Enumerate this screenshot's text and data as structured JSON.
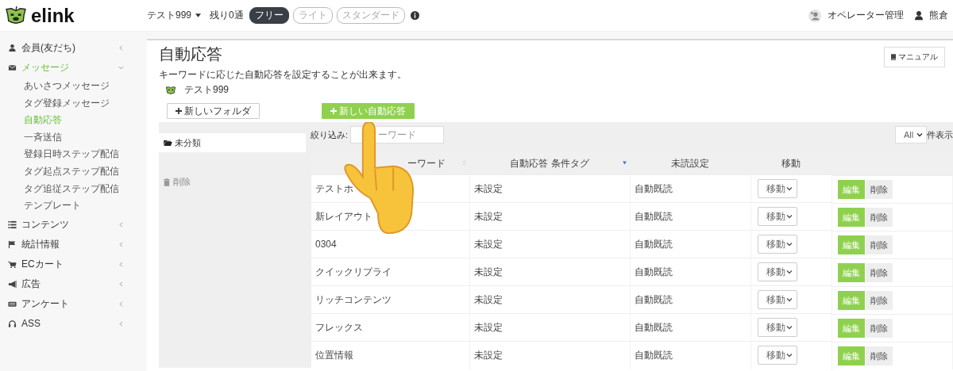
{
  "header": {
    "logo": "elink",
    "account": "テスト999",
    "remaining": "残り0通",
    "plans": [
      {
        "label": "フリー",
        "selected": true
      },
      {
        "label": "ライト",
        "selected": false
      },
      {
        "label": "スタンダード",
        "selected": false
      }
    ],
    "operator": "オペレーター管理",
    "user": "熊倉"
  },
  "sidebar": {
    "items": [
      {
        "label": "会員(友だち)",
        "selected": false,
        "expanded": false
      },
      {
        "label": "メッセージ",
        "selected": true,
        "expanded": true,
        "children": [
          {
            "label": "あいさつメッセージ",
            "selected": false
          },
          {
            "label": "タグ登録メッセージ",
            "selected": false
          },
          {
            "label": "自動応答",
            "selected": true
          },
          {
            "label": "一斉送信",
            "selected": false
          },
          {
            "label": "登録日時ステップ配信",
            "selected": false
          },
          {
            "label": "タグ起点ステップ配信",
            "selected": false
          },
          {
            "label": "タグ追従ステップ配信",
            "selected": false
          },
          {
            "label": "テンプレート",
            "selected": false
          }
        ]
      },
      {
        "label": "コンテンツ",
        "selected": false,
        "expanded": false
      },
      {
        "label": "統計情報",
        "selected": false,
        "expanded": false
      },
      {
        "label": "ECカート",
        "selected": false,
        "expanded": false
      },
      {
        "label": "広告",
        "selected": false,
        "expanded": false
      },
      {
        "label": "アンケート",
        "selected": false,
        "expanded": false
      },
      {
        "label": "ASS",
        "selected": false,
        "expanded": false
      }
    ]
  },
  "page": {
    "title": "自動応答",
    "description": "キーワードに応じた自動応答を設定することが出来ます。",
    "account_name": "テスト999",
    "manual_button": "マニュアル",
    "new_folder_button": "新しいフォルダ",
    "new_response_button": "新しい自動応答"
  },
  "folders": [
    {
      "label": "未分類",
      "selected": true
    }
  ],
  "trash": "削除",
  "filter": {
    "label": "絞り込み:",
    "placeholder": "ーワード"
  },
  "page_size": {
    "value": "All",
    "suffix": "件表示"
  },
  "table": {
    "columns": [
      "ーワード",
      "自動応答 条件タグ",
      "未読設定",
      "移動"
    ],
    "rows": [
      {
        "keyword": "テストホ",
        "tag": "未設定",
        "unread": "自動既読",
        "move": "移動",
        "edit": "編集",
        "delete": "削除"
      },
      {
        "keyword": "新レイアウト",
        "tag": "未設定",
        "unread": "自動既読",
        "move": "移動",
        "edit": "編集",
        "delete": "削除"
      },
      {
        "keyword": "0304",
        "tag": "未設定",
        "unread": "自動既読",
        "move": "移動",
        "edit": "編集",
        "delete": "削除"
      },
      {
        "keyword": "クイックリプライ",
        "tag": "未設定",
        "unread": "自動既読",
        "move": "移動",
        "edit": "編集",
        "delete": "削除"
      },
      {
        "keyword": "リッチコンテンツ",
        "tag": "未設定",
        "unread": "自動既読",
        "move": "移動",
        "edit": "編集",
        "delete": "削除"
      },
      {
        "keyword": "フレックス",
        "tag": "未設定",
        "unread": "自動既読",
        "move": "移動",
        "edit": "編集",
        "delete": "削除"
      },
      {
        "keyword": "位置情報",
        "tag": "未設定",
        "unread": "自動既読",
        "move": "移動",
        "edit": "編集",
        "delete": "削除"
      }
    ]
  }
}
